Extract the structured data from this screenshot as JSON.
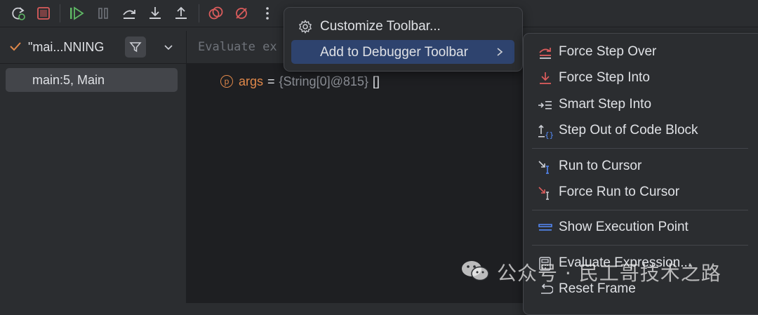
{
  "toolbar": {
    "buttons": [
      "rerun-icon",
      "stop-icon",
      "resume-icon",
      "pause-icon",
      "step-over-icon",
      "step-into-icon",
      "step-out-icon",
      "view-breakpoints-icon",
      "mute-breakpoints-icon",
      "more-icon"
    ]
  },
  "threads": {
    "selected": "\"mai...NNING"
  },
  "frames": [
    {
      "label": "main:5, Main"
    }
  ],
  "evaluate": {
    "placeholder": "Evaluate ex"
  },
  "variables": [
    {
      "badge": "p",
      "name": "args",
      "eq": "=",
      "type": "{String[0]@815}",
      "value": "[]"
    }
  ],
  "context_menu": {
    "items": [
      {
        "label": "Customize Toolbar...",
        "icon": "gear-icon"
      },
      {
        "label": "Add to Debugger Toolbar",
        "icon": "",
        "has_submenu": true
      }
    ]
  },
  "submenu": {
    "groups": [
      [
        {
          "label": "Force Step Over",
          "icon": "force-step-over-icon"
        },
        {
          "label": "Force Step Into",
          "icon": "force-step-into-icon"
        },
        {
          "label": "Smart Step Into",
          "icon": "smart-step-into-icon"
        },
        {
          "label": "Step Out of Code Block",
          "icon": "step-out-code-block-icon"
        }
      ],
      [
        {
          "label": "Run to Cursor",
          "icon": "run-to-cursor-icon"
        },
        {
          "label": "Force Run to Cursor",
          "icon": "force-run-to-cursor-icon"
        }
      ],
      [
        {
          "label": "Show Execution Point",
          "icon": "show-execution-point-icon"
        }
      ],
      [
        {
          "label": "Evaluate Expression...",
          "icon": "evaluate-expression-icon"
        },
        {
          "label": "Reset Frame",
          "icon": "reset-frame-icon"
        }
      ]
    ]
  },
  "watermark": {
    "text": "公众号 · 民工哥技术之路"
  },
  "colors": {
    "accent": "#2e436e",
    "red": "#db5c5c",
    "green": "#5fb865",
    "orange": "#e0884a",
    "blue": "#548af7"
  }
}
